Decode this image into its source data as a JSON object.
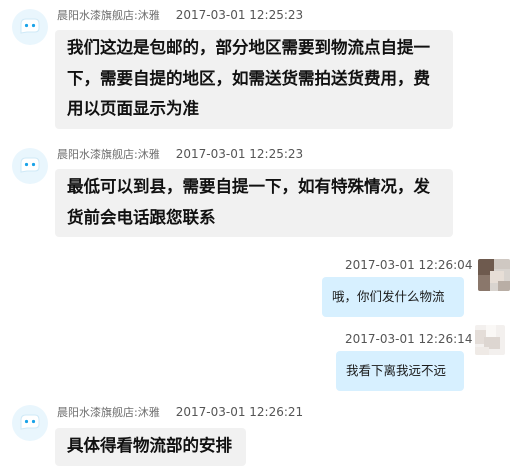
{
  "conversation": {
    "messages": [
      {
        "side": "left",
        "sender": "晨阳水漆旗舰店:沐雅",
        "time": "2017-03-01 12:25:23",
        "text": "我们这边是包邮的，部分地区需要到物流点自提一下，需要自提的地区，如需送货需拍送货费用，费用以页面显示为准"
      },
      {
        "side": "left",
        "sender": "晨阳水漆旗舰店:沐雅",
        "time": "2017-03-01 12:25:23",
        "text": "最低可以到县，需要自提一下，如有特殊情况，发货前会电话跟您联系"
      },
      {
        "side": "right",
        "time": "2017-03-01 12:26:04",
        "text": "哦，你们发什么物流"
      },
      {
        "side": "right",
        "time": "2017-03-01 12:26:14",
        "text": "我看下离我远不远"
      },
      {
        "side": "left",
        "sender": "晨阳水漆旗舰店:沐雅",
        "time": "2017-03-01 12:26:21",
        "text": "具体得看物流部的安排"
      }
    ]
  },
  "icons": {
    "seller_avatar": "seller-avatar-icon",
    "user_avatar": "user-avatar-icon"
  },
  "colors": {
    "seller_bubble": "#f1f1f1",
    "user_bubble": "#d7f0ff",
    "avatar_bg": "#e9f6fd",
    "accent": "#1aa3e8"
  }
}
